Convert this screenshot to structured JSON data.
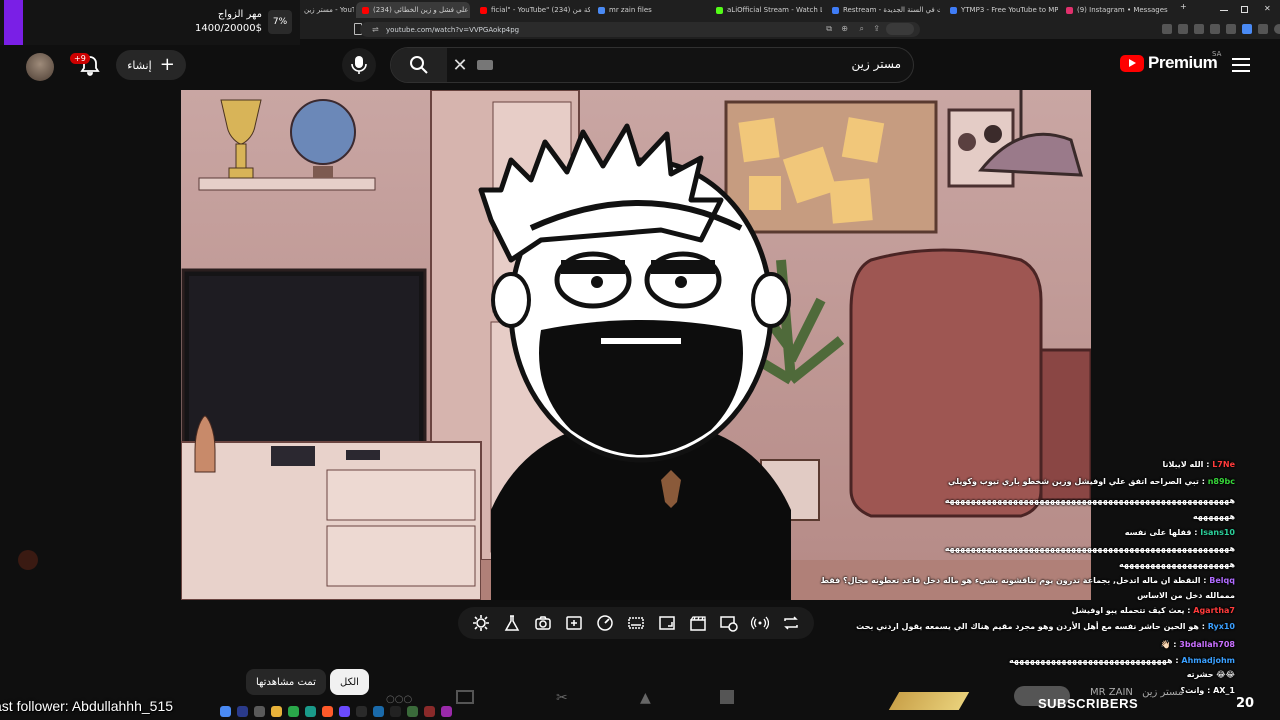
{
  "browser": {
    "tabs": [
      {
        "title": "مستر زين - YouTube",
        "favicon": "youtube-icon",
        "color": "#ff0000"
      },
      {
        "title": "(234) علي فشل و زين الخطائي",
        "favicon": "youtube-icon",
        "color": "#ff0000",
        "active": true
      },
      {
        "title": "ficial\" - YouTube\" مشاركة من (234)",
        "favicon": "youtube-icon",
        "color": "#ff0000"
      },
      {
        "title": "mr zain files",
        "favicon": "folder-icon",
        "color": "#4a8af4"
      },
      {
        "title": "aLiOfficial Stream - Watch Live",
        "favicon": "kick-icon",
        "color": "#53fc18"
      },
      {
        "title": "Restream - اول بث في السنة الجديدة",
        "favicon": "restream-icon",
        "color": "#3f7cf6"
      },
      {
        "title": "YTMP3 - Free YouTube to MP3 Co",
        "favicon": "ytmp3-icon",
        "color": "#3f7cf6"
      },
      {
        "title": "(9) Instagram • Messages",
        "favicon": "instagram-icon",
        "color": "#e1306c"
      }
    ],
    "new_tab": "+",
    "url": "youtube.com/watch?v=VVPGAokp4pg"
  },
  "goal_overlay": {
    "title": "مهر الزواج",
    "progress_text": "1400/20000$",
    "percent": "7%",
    "progress": 0.07,
    "color": "#7a1fe6"
  },
  "youtube_header": {
    "notification_count": "+9",
    "create_label": "إنشاء",
    "search_query": "مستر زين",
    "logo_text": "Premium",
    "country_code": "SA"
  },
  "chips": [
    {
      "label": "الكل",
      "selected": true
    },
    {
      "label": "تمت مشاهدتها",
      "selected": false
    }
  ],
  "player_controls": [
    "gear-icon",
    "flask-icon",
    "camera-icon",
    "add-frame-icon",
    "speed-icon",
    "subtitles-icon",
    "aspect-icon",
    "clapper-icon",
    "cast-icon",
    "broadcast-icon",
    "loop-icon"
  ],
  "chat": {
    "messages": [
      {
        "user": "L7Ne",
        "user_color": "#ff3b3b",
        "text": "الله لايبلانا"
      },
      {
        "user": "n89bc",
        "user_color": "#37d63a",
        "text": "تبي الصراحه اتفق علي اوفيشل وزين شخطو باري تيوب وكويلي"
      },
      {
        "user": "",
        "user_color": "#ffffff",
        "text": "ههههههههههههههههههههههههههههههههههههههههههههههههههههههه"
      },
      {
        "user": "",
        "user_color": "#ffffff",
        "text": "هههههههه"
      },
      {
        "user": "Isans10",
        "user_color": "#2ccf9a",
        "text": "قفلها على نفسه"
      },
      {
        "user": "",
        "user_color": "#ffffff",
        "text": "ههههههههههههههههههههههههههههههههههههههههههههههههههههههه"
      },
      {
        "user": "",
        "user_color": "#ffffff",
        "text": "هههههههههههههههههههههه"
      },
      {
        "user": "Belqq",
        "user_color": "#b06cff",
        "text": "النقطة ان ماله اتدخل, بجماعة تدرون يوم تناقشونه بشيء هو ماله دخل قاعد تعطونه مجال؟ فقط"
      },
      {
        "user": "",
        "user_color": "#ffffff",
        "text": "مممالله دخل من الاساس"
      },
      {
        "user": "Agartha7",
        "user_color": "#ff3b3b",
        "text": "يعث كيف تتحمله يبو اوفيشل"
      },
      {
        "user": "Ryx10",
        "user_color": "#3ba0ff",
        "text": "هو الحين حاشر نفسه مع أهل الأردن وهو مجرد مقيم هناك الي يسمعه يقول اردني بحت"
      },
      {
        "user": "3bdallah708",
        "user_color": "#c970ff",
        "text": "👋🏻"
      },
      {
        "user": "Ahmadjohm",
        "user_color": "#3ba0ff",
        "text": "ههههههههههههههههههههههههههههههه"
      },
      {
        "user": "",
        "user_color": "#ffffff",
        "text": "😂😂 حشرته"
      },
      {
        "user": "AX_1",
        "user_color": "#ffffff",
        "text": "وانت؟"
      }
    ]
  },
  "stream_overlay": {
    "follower_text": "ast follower: Abdullahhh_515",
    "subscribers_label": "SUBSCRIBERS",
    "subscribers_count": "20",
    "channel_name": "MR ZAIN",
    "channel_name_ar": "مستر زين"
  }
}
